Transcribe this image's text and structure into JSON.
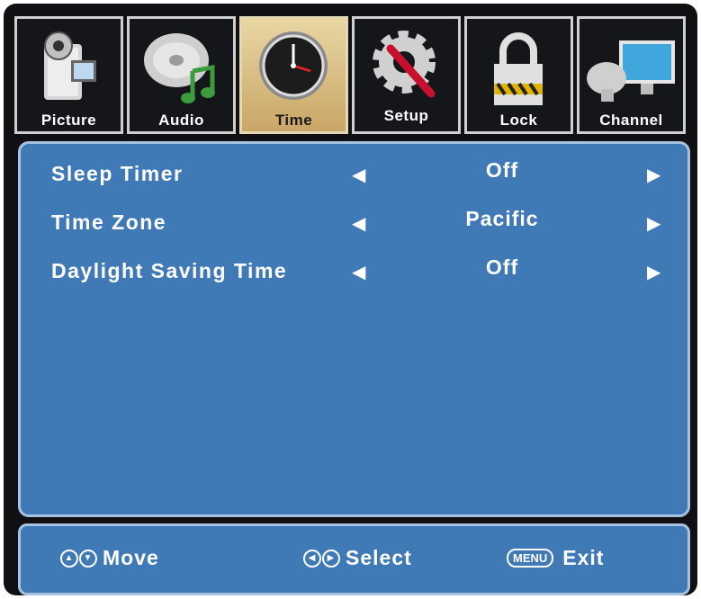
{
  "tabs": [
    {
      "label": "Picture",
      "icon": "camcorder-icon"
    },
    {
      "label": "Audio",
      "icon": "audio-disc-icon"
    },
    {
      "label": "Time",
      "icon": "clock-icon",
      "active": true
    },
    {
      "label": "Setup",
      "icon": "gear-wrench-icon"
    },
    {
      "label": "Lock",
      "icon": "padlock-icon"
    },
    {
      "label": "Channel",
      "icon": "satellite-monitor-icon"
    }
  ],
  "settings": [
    {
      "name": "Sleep Timer",
      "value": "Off"
    },
    {
      "name": "Time Zone",
      "value": "Pacific"
    },
    {
      "name": "Daylight Saving Time",
      "value": "Off"
    }
  ],
  "footer": {
    "move_label": "Move",
    "select_label": "Select",
    "menu_key": "MENU",
    "exit_label": "Exit"
  },
  "colors": {
    "panel_blue": "#3f79b6",
    "active_tab_gold": "#d8bd80",
    "frame_dark": "#101014"
  }
}
